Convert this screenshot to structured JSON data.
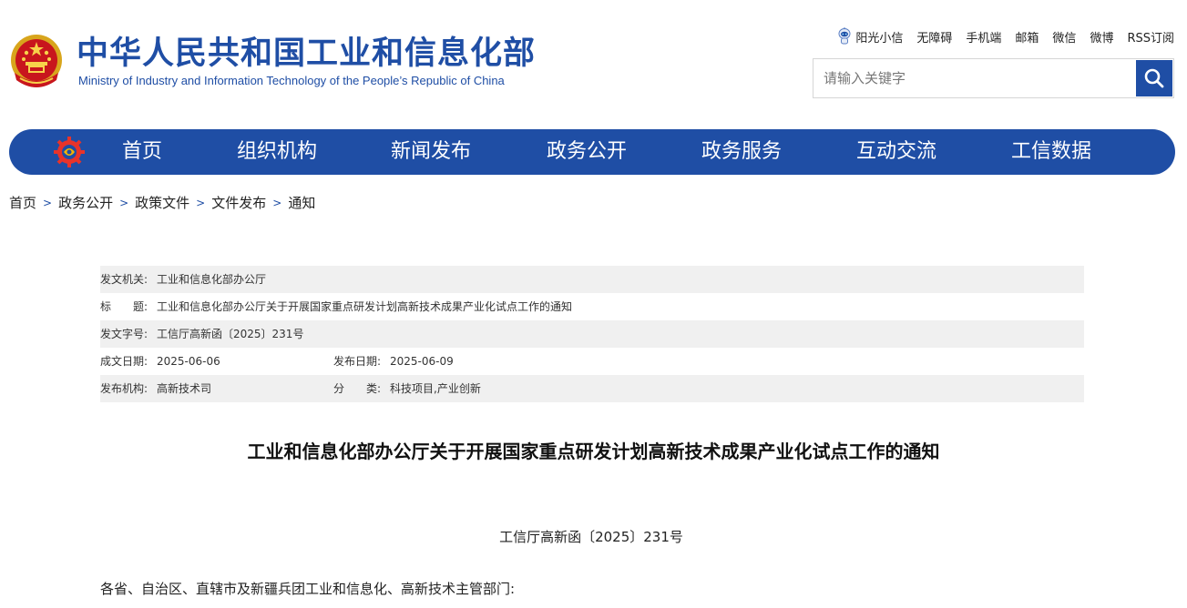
{
  "header": {
    "title": "中华人民共和国工业和信息化部",
    "subtitle": "Ministry of Industry and Information Technology of the People’s Republic of China",
    "emblem_icon": "national-emblem-icon"
  },
  "toplinks": [
    {
      "label": "阳光小信",
      "icon": "robot-icon"
    },
    {
      "label": "无障碍"
    },
    {
      "label": "手机端"
    },
    {
      "label": "邮箱"
    },
    {
      "label": "微信"
    },
    {
      "label": "微博"
    },
    {
      "label": "RSS订阅"
    }
  ],
  "search": {
    "placeholder": "请输入关键字",
    "value": "",
    "icon": "search-icon"
  },
  "nav": {
    "logo_icon": "gear-logo-icon",
    "items": [
      "首页",
      "组织机构",
      "新闻发布",
      "政务公开",
      "政务服务",
      "互动交流",
      "工信数据"
    ]
  },
  "breadcrumb": [
    "首页",
    "政务公开",
    "政策文件",
    "文件发布",
    "通知"
  ],
  "meta": {
    "issuer_label": "发文机关:",
    "issuer": "工业和信息化部办公厅",
    "title_label_1": "标",
    "title_label_2": "题:",
    "title": "工业和信息化部办公厅关于开展国家重点研发计划高新技术成果产业化试点工作的通知",
    "docno_label": "发文字号:",
    "docno": "工信厅高新函〔2025〕231号",
    "created_label": "成文日期:",
    "created": "2025-06-06",
    "published_label": "发布日期:",
    "published": "2025-06-09",
    "org_label": "发布机构:",
    "org": "高新技术司",
    "category_label_1": "分",
    "category_label_2": "类:",
    "category": "科技项目,产业创新"
  },
  "article": {
    "title": "工业和信息化部办公厅关于开展国家重点研发计划高新技术成果产业化试点工作的通知",
    "doc_number": "工信厅高新函〔2025〕231号",
    "salutation": "各省、自治区、直辖市及新疆兵团工业和信息化、高新技术主管部门:"
  },
  "colors": {
    "brand_blue": "#1f4ea5",
    "row_shade": "#f0f0f0"
  }
}
